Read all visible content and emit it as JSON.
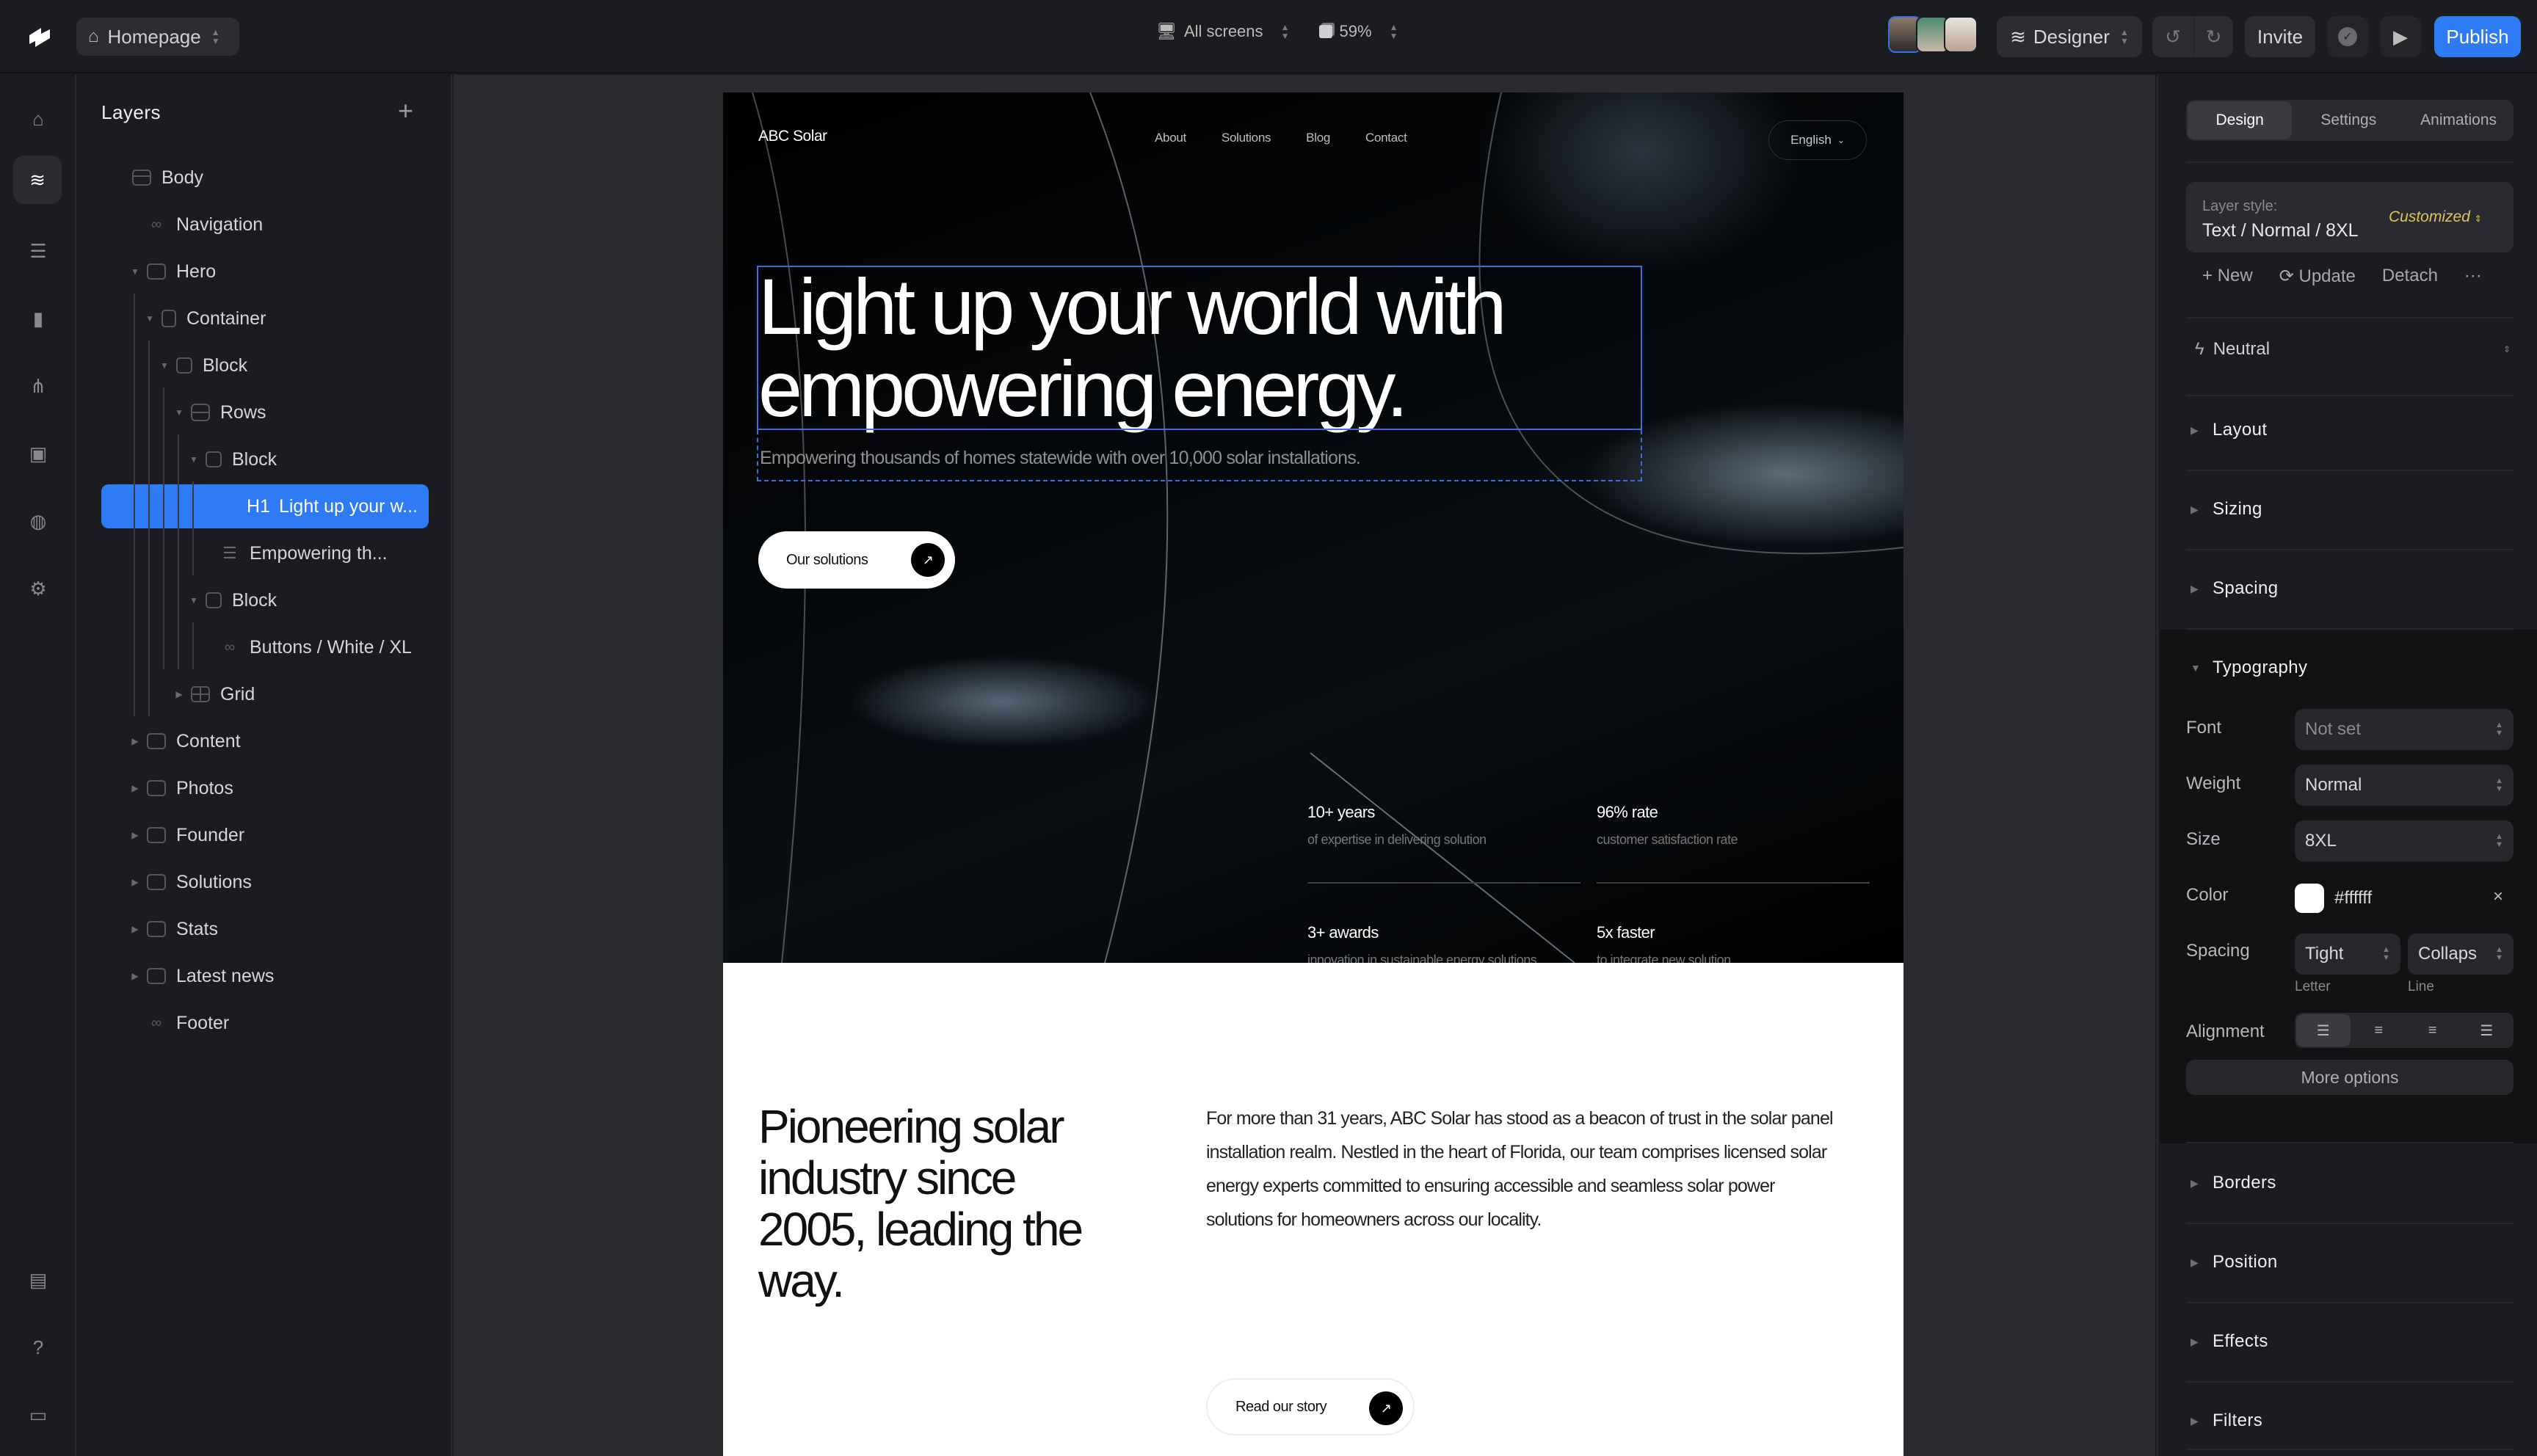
{
  "topbar": {
    "page_selector": "Homepage",
    "screens": "All screens",
    "zoom": "59%",
    "mode": "Designer",
    "invite": "Invite",
    "publish": "Publish",
    "colors": {
      "accent": "#2f7bf5"
    }
  },
  "rail": {
    "icons": [
      "home-icon",
      "layers-icon",
      "cms-icon",
      "pages-icon",
      "components-icon",
      "assets-icon",
      "globe-icon",
      "settings-icon",
      "changelog-icon",
      "help-icon",
      "feedback-icon"
    ]
  },
  "layers": {
    "title": "Layers",
    "items": [
      {
        "label": "Body",
        "level": 0,
        "icon": "body"
      },
      {
        "label": "Navigation",
        "level": 1,
        "icon": "component"
      },
      {
        "label": "Hero",
        "level": 1,
        "icon": "section",
        "expanded": true
      },
      {
        "label": "Container",
        "level": 2,
        "icon": "container",
        "expanded": true
      },
      {
        "label": "Block",
        "level": 3,
        "icon": "block",
        "expanded": true
      },
      {
        "label": "Rows",
        "level": 4,
        "icon": "rows",
        "expanded": true
      },
      {
        "label": "Block",
        "level": 5,
        "icon": "block",
        "expanded": true
      },
      {
        "label": "Light up your w...",
        "tag": "H1",
        "level": 6,
        "icon": "heading",
        "selected": true
      },
      {
        "label": "Empowering th...",
        "level": 6,
        "icon": "text"
      },
      {
        "label": "Block",
        "level": 5,
        "icon": "block",
        "expanded": true
      },
      {
        "label": "Buttons / White / XL",
        "level": 6,
        "icon": "component"
      },
      {
        "label": "Grid",
        "level": 4,
        "icon": "grid",
        "expanded": false
      },
      {
        "label": "Content",
        "level": 1,
        "icon": "section",
        "expanded": false
      },
      {
        "label": "Photos",
        "level": 1,
        "icon": "section",
        "expanded": false
      },
      {
        "label": "Founder",
        "level": 1,
        "icon": "section",
        "expanded": false
      },
      {
        "label": "Solutions",
        "level": 1,
        "icon": "section",
        "expanded": false
      },
      {
        "label": "Stats",
        "level": 1,
        "icon": "section",
        "expanded": false
      },
      {
        "label": "Latest news",
        "level": 1,
        "icon": "section",
        "expanded": false
      },
      {
        "label": "Footer",
        "level": 1,
        "icon": "component"
      }
    ]
  },
  "site": {
    "brand": "ABC Solar",
    "nav": [
      "About",
      "Solutions",
      "Blog",
      "Contact"
    ],
    "language": "English",
    "h1": "Light up your world with empowering energy.",
    "subtitle": "Empowering thousands of homes statewide with over 10,000 solar installations.",
    "cta": "Our solutions",
    "stats": [
      {
        "title": "10+ years",
        "desc": "of expertise in delivering solution"
      },
      {
        "title": "96% rate",
        "desc": "customer satisfaction rate"
      },
      {
        "title": "3+ awards",
        "desc": "innovation in sustainable energy solutions"
      },
      {
        "title": "5x faster",
        "desc": "to integrate new solution"
      }
    ],
    "about_heading": "Pioneering solar industry since 2005, leading the way.",
    "about_text": "For more than 31 years, ABC Solar has stood as a beacon of trust in the solar panel installation realm. Nestled in the heart of Florida, our team comprises licensed solar energy experts committed to ensuring accessible and seamless solar power solutions for homeowners across our locality.",
    "about_cta": "Read our story"
  },
  "props": {
    "tabs": [
      "Design",
      "Settings",
      "Animations"
    ],
    "active_tab": "Design",
    "layer_style_label": "Layer style:",
    "layer_style_value": "Text / Normal / 8XL",
    "layer_style_state": "Customized",
    "actions": {
      "new": "New",
      "update": "Update",
      "detach": "Detach",
      "more": "···"
    },
    "theme": "Neutral",
    "sections_top": [
      "Layout",
      "Sizing",
      "Spacing"
    ],
    "typography": {
      "title": "Typography",
      "font_label": "Font",
      "font_value": "Not set",
      "weight_label": "Weight",
      "weight_value": "Normal",
      "size_label": "Size",
      "size_value": "8XL",
      "color_label": "Color",
      "color_value": "#ffffff",
      "spacing_label": "Spacing",
      "letter_value": "Tight",
      "line_value": "Collaps",
      "letter_label": "Letter",
      "line_label": "Line",
      "alignment_label": "Alignment",
      "alignment_options": [
        "left",
        "center",
        "right",
        "justify"
      ],
      "alignment_active": "left",
      "more_options": "More options"
    },
    "sections_bottom": [
      "Borders",
      "Position",
      "Effects",
      "Filters"
    ],
    "colors": {
      "customized": "#e6c253"
    }
  }
}
